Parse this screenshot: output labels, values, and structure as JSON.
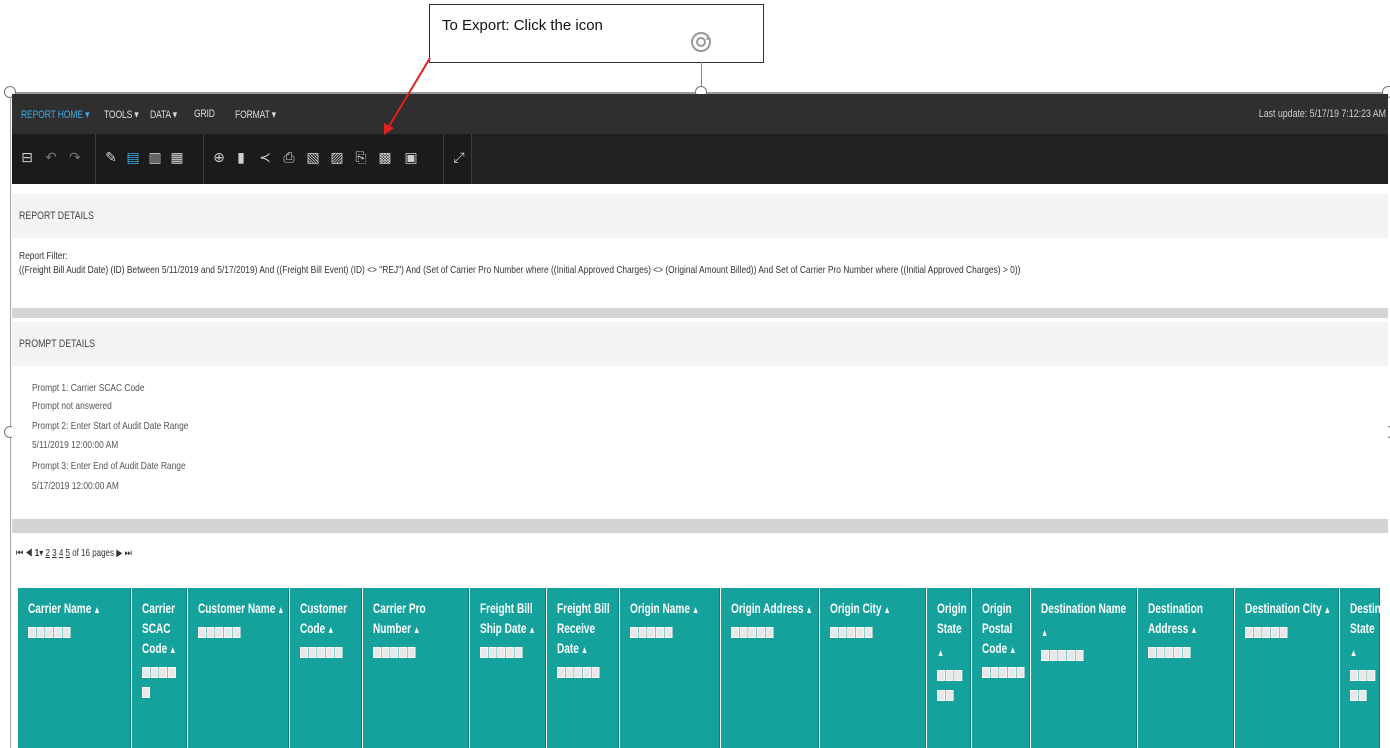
{
  "callout": {
    "text": "To Export: Click the icon"
  },
  "menu": {
    "items": [
      "REPORT HOME ▾",
      "TOOLS ▾",
      "DATA ▾",
      "GRID",
      "FORMAT ▾"
    ],
    "last_update": "Last update: 5/17/19 7:12:23 AM"
  },
  "toolbar": {
    "icons": [
      "save-icon",
      "undo-icon",
      "redo-icon",
      "edit-icon",
      "grid-view-icon",
      "chart-view-icon",
      "grid-chart-icon",
      "add-data-icon",
      "bookmark-icon",
      "share-icon",
      "print-icon",
      "export-pdf-icon",
      "export-excel-icon",
      "export-icon",
      "export-csv-icon",
      "export-html-icon",
      "fullscreen-icon"
    ]
  },
  "report_details": {
    "heading": "REPORT DETAILS",
    "filter_label": "Report Filter:",
    "filter_text": "((Freight Bill Audit Date) (ID) Between 5/11/2019 and 5/17/2019) And ((Freight Bill Event) (ID) <> \"REJ\") And (Set of  Carrier Pro Number where ((Initial Approved Charges) <> (Original Amount Billed)) And Set of  Carrier Pro Number where ((Initial Approved Charges) > 0))"
  },
  "prompt_details": {
    "heading": "PROMPT DETAILS",
    "lines": [
      "Prompt 1: Carrier SCAC Code",
      "Prompt not answered",
      "Prompt 2: Enter Start of Audit Date Range",
      "5/11/2019 12:00:00 AM",
      "Prompt 3: Enter End of Audit Date Range",
      "5/17/2019 12:00:00 AM"
    ]
  },
  "pager": {
    "current": "1",
    "pages": [
      "2",
      "3",
      "4",
      "5"
    ],
    "total_text": "of 16 pages"
  },
  "columns": [
    "Carrier Name",
    "Carrier SCAC Code",
    "Customer Name",
    "Customer Code",
    "Carrier Pro Number",
    "Freight Bill Ship Date",
    "Freight Bill Receive Date",
    "Origin Name",
    "Origin Address",
    "Origin City",
    "Origin State",
    "Origin Postal Code",
    "Destination Name",
    "Destination Address",
    "Destination City",
    "Destination State"
  ],
  "colors": {
    "header_teal": "#15a19c",
    "menu_active": "#3fa9e8",
    "arrow": "#e02020"
  }
}
